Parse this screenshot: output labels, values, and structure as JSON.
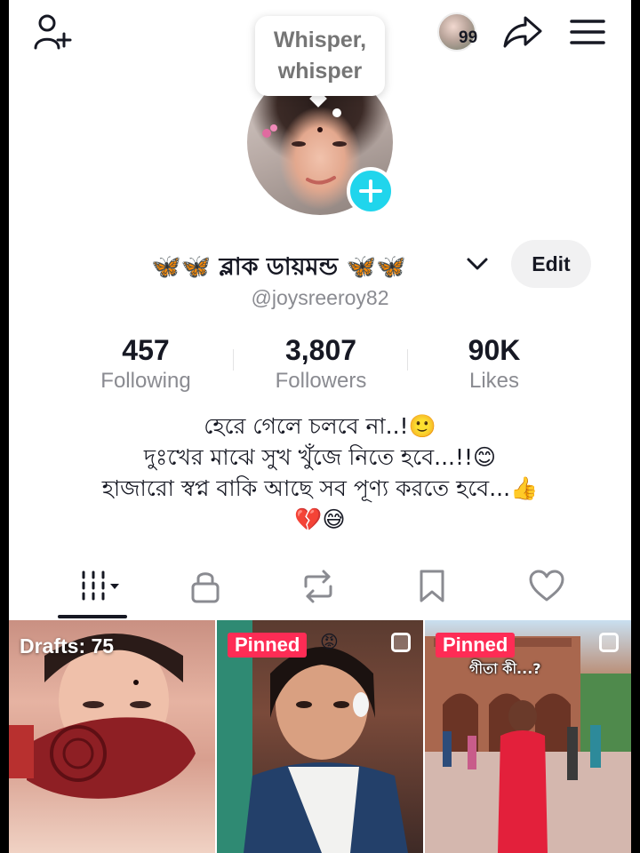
{
  "tooltip": {
    "line1": "Whisper,",
    "line2": "whisper"
  },
  "header": {
    "notifications_count": "99"
  },
  "profile": {
    "display_name": "🦋🦋 ব্লাক ডায়মন্ড 🦋🦋",
    "handle": "@joysreeroy82",
    "edit_label": "Edit"
  },
  "stats": [
    {
      "value": "457",
      "label": "Following"
    },
    {
      "value": "3,807",
      "label": "Followers"
    },
    {
      "value": "90K",
      "label": "Likes"
    }
  ],
  "bio": [
    "হেরে গেলে চলবে না..!🙂",
    "দুঃখের মাঝে সুখ খুঁজে নিতে হবে...!!😊",
    "হাজারো স্বপ্ন বাকি আছে সব পূণ্য করতে হবে...👍",
    "💔😅"
  ],
  "grid": [
    {
      "label": "Drafts: 75"
    },
    {
      "label": "Pinned",
      "emoji": "😡"
    },
    {
      "label": "Pinned",
      "caption": "গীতা কী...?"
    }
  ],
  "colors": {
    "accent_pink": "#fe2c55",
    "accent_cyan": "#20d5ec"
  }
}
